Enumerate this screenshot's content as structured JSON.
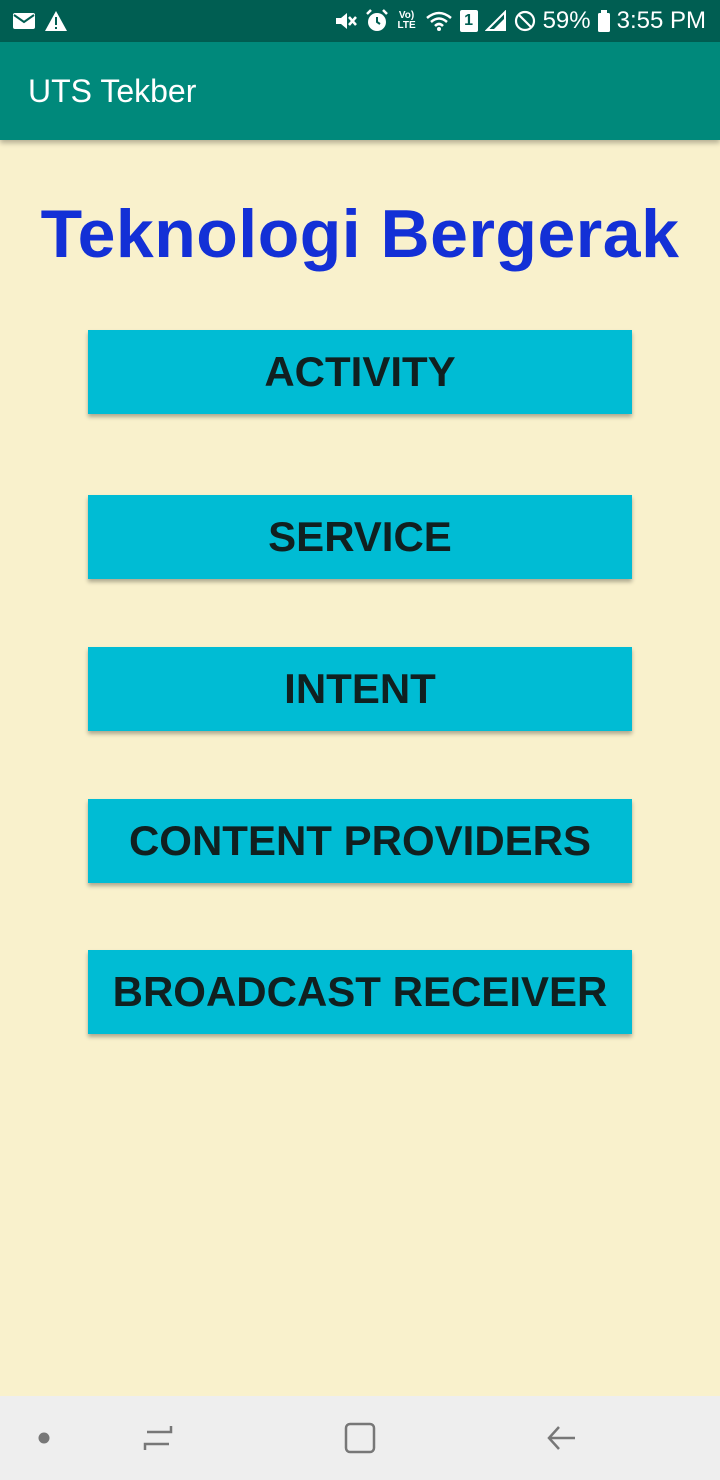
{
  "status_bar": {
    "notification_icons": [
      "mail-icon",
      "warning-icon"
    ],
    "system_icons": [
      "mute-icon",
      "alarm-icon",
      "volte-icon",
      "wifi-icon",
      "sim-icon",
      "signal-icon",
      "do-not-disturb-icon",
      "battery-icon"
    ],
    "volte_label": "Vo) LTE",
    "sim_label": "1",
    "battery": "59%",
    "time": "3:55 PM"
  },
  "app_bar": {
    "title": "UTS Tekber"
  },
  "main": {
    "heading": "Teknologi Bergerak",
    "buttons": [
      {
        "label": "ACTIVITY"
      },
      {
        "label": "SERVICE"
      },
      {
        "label": "INTENT"
      },
      {
        "label": "CONTENT PROVIDERS"
      },
      {
        "label": "BROADCAST RECEIVER"
      }
    ]
  },
  "nav_bar": {
    "items": [
      "dot-icon",
      "recents-icon",
      "home-icon",
      "back-icon"
    ]
  },
  "colors": {
    "status_bar": "#005e52",
    "app_bar": "#00897b",
    "background": "#f9f1cc",
    "heading": "#1330d6",
    "button": "#00bcd4",
    "button_text": "#102020",
    "nav_bar": "#eeeeee"
  }
}
